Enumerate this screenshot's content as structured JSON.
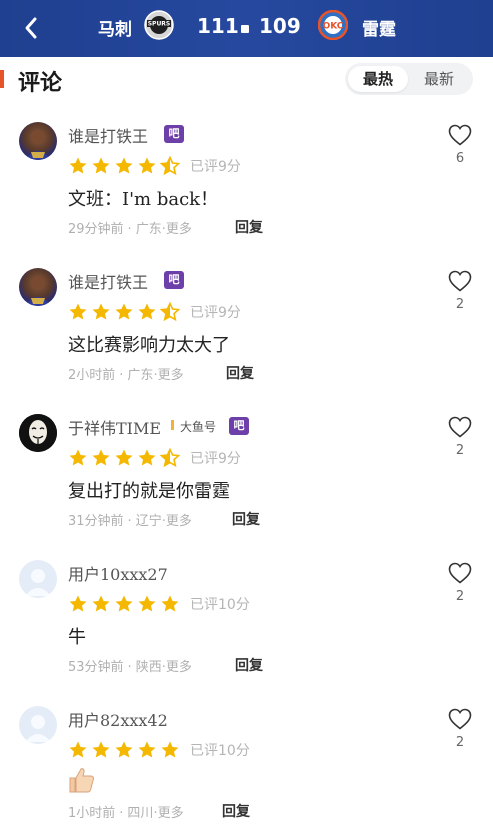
{
  "header": {
    "home_team": "马刺",
    "home_score": "111",
    "away_score": "109",
    "away_team": "雷霆",
    "home_logo_text": "SPURS",
    "away_logo_text": "OKC"
  },
  "section": {
    "title": "评论",
    "sort_hot": "最热",
    "sort_new": "最新"
  },
  "comments": [
    {
      "username": "谁是打铁王",
      "badge": "吧",
      "rating": 4.5,
      "rating_text": "已评9分",
      "text": "文班：I'm back！",
      "time": "29分钟前",
      "location": "广东",
      "more": "更多",
      "reply": "回复",
      "likes": "6",
      "avatar": "player-avatar"
    },
    {
      "username": "谁是打铁王",
      "badge": "吧",
      "rating": 4.5,
      "rating_text": "已评9分",
      "text": "这比赛影响力太大了",
      "time": "2小时前",
      "location": "广东",
      "more": "更多",
      "reply": "回复",
      "likes": "2",
      "avatar": "player-avatar"
    },
    {
      "username": "于祥伟TIME",
      "tag": "大鱼号",
      "badge": "吧",
      "rating": 4.5,
      "rating_text": "已评9分",
      "text": "复出打的就是你雷霆",
      "time": "31分钟前",
      "location": "辽宁",
      "more": "更多",
      "reply": "回复",
      "likes": "2",
      "avatar": "mask-avatar"
    },
    {
      "username": "用户10xxx27",
      "rating": 5,
      "rating_text": "已评10分",
      "text": "牛",
      "time": "53分钟前",
      "location": "陕西",
      "more": "更多",
      "reply": "回复",
      "likes": "2",
      "avatar": "default-avatar"
    },
    {
      "username": "用户82xxx42",
      "rating": 5,
      "rating_text": "已评10分",
      "text": "",
      "emoji": "thumbs-up-icon",
      "time": "1小时前",
      "location": "四川",
      "more": "更多",
      "reply": "回复",
      "likes": "2",
      "avatar": "default-avatar"
    }
  ],
  "colors": {
    "header_bg": "#26499f",
    "accent": "#e8542a",
    "star": "#f5b800",
    "badge": "#6d3fa8"
  }
}
